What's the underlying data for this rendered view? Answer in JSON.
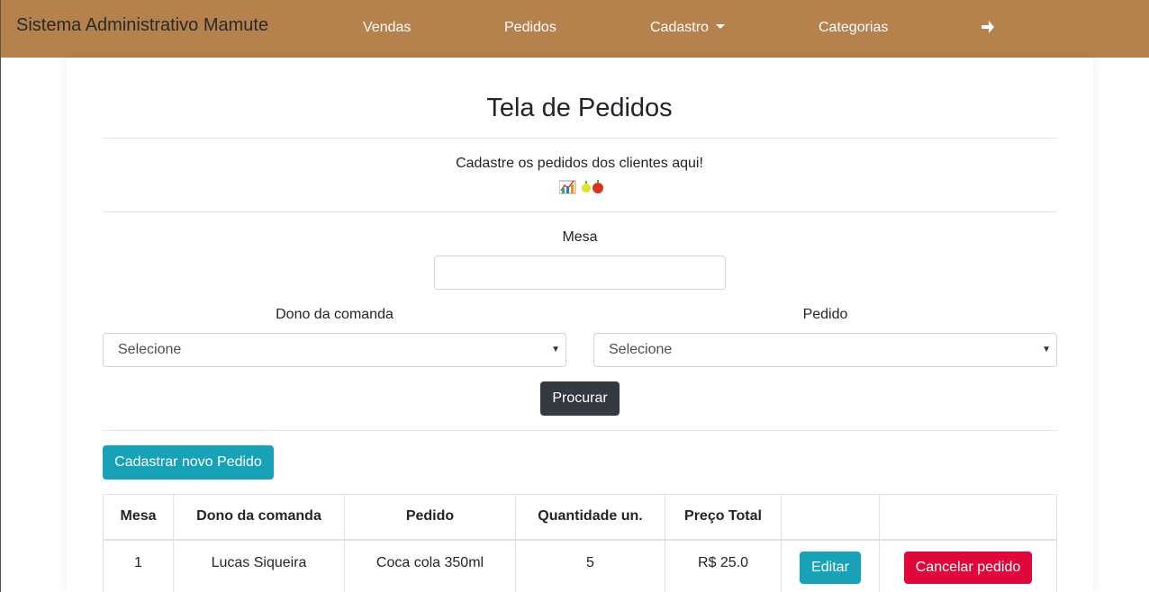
{
  "navbar": {
    "brand": "Sistema Administrativo Mamute",
    "items": [
      "Vendas",
      "Pedidos",
      "Cadastro",
      "Categorias"
    ],
    "logout_icon": "arrow-right-icon"
  },
  "page": {
    "title": "Tela de Pedidos",
    "subtitle": "Cadastre os pedidos dos clientes aqui!",
    "emoji": "chart, lemon and apple emoji"
  },
  "form": {
    "mesa_label": "Mesa",
    "mesa_value": "",
    "dono_label": "Dono da comanda",
    "dono_selected": "Selecione",
    "pedido_label": "Pedido",
    "pedido_selected": "Selecione",
    "search_button": "Procurar"
  },
  "actions": {
    "new_order_button": "Cadastrar novo Pedido"
  },
  "table": {
    "headers": [
      "Mesa",
      "Dono da comanda",
      "Pedido",
      "Quantidade un.",
      "Preço Total"
    ],
    "rows": [
      {
        "mesa": "1",
        "dono": "Lucas Siqueira",
        "pedido": "Coca cola 350ml",
        "quantidade": "5",
        "preco": "R$ 25.0",
        "edit_label": "Editar",
        "cancel_label": "Cancelar pedido"
      }
    ]
  },
  "colors": {
    "navbar": "#b5814c",
    "primary_info": "#17a2b8",
    "danger": "#e0083a",
    "dark": "#343a40"
  }
}
